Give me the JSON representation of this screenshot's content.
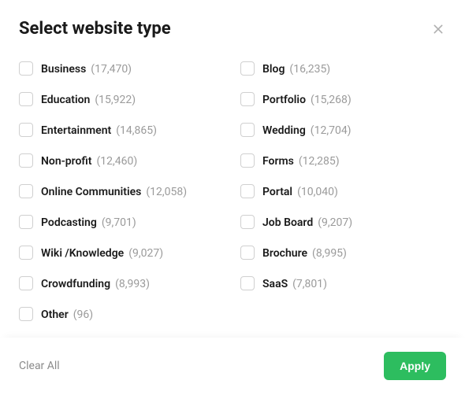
{
  "title": "Select website type",
  "options": [
    {
      "label": "Business",
      "count": "(17,470)"
    },
    {
      "label": "Blog",
      "count": "(16,235)"
    },
    {
      "label": "Education",
      "count": "(15,922)"
    },
    {
      "label": "Portfolio",
      "count": "(15,268)"
    },
    {
      "label": "Entertainment",
      "count": "(14,865)"
    },
    {
      "label": "Wedding",
      "count": "(12,704)"
    },
    {
      "label": "Non-profit",
      "count": "(12,460)"
    },
    {
      "label": "Forms",
      "count": "(12,285)"
    },
    {
      "label": "Online Communities",
      "count": "(12,058)"
    },
    {
      "label": "Portal",
      "count": "(10,040)"
    },
    {
      "label": "Podcasting",
      "count": "(9,701)"
    },
    {
      "label": "Job Board",
      "count": "(9,207)"
    },
    {
      "label": "Wiki /Knowledge",
      "count": "(9,027)"
    },
    {
      "label": "Brochure",
      "count": "(8,995)"
    },
    {
      "label": "Crowdfunding",
      "count": "(8,993)"
    },
    {
      "label": "SaaS",
      "count": "(7,801)"
    },
    {
      "label": "Other",
      "count": "(96)"
    }
  ],
  "footer": {
    "clear": "Clear All",
    "apply": "Apply"
  }
}
